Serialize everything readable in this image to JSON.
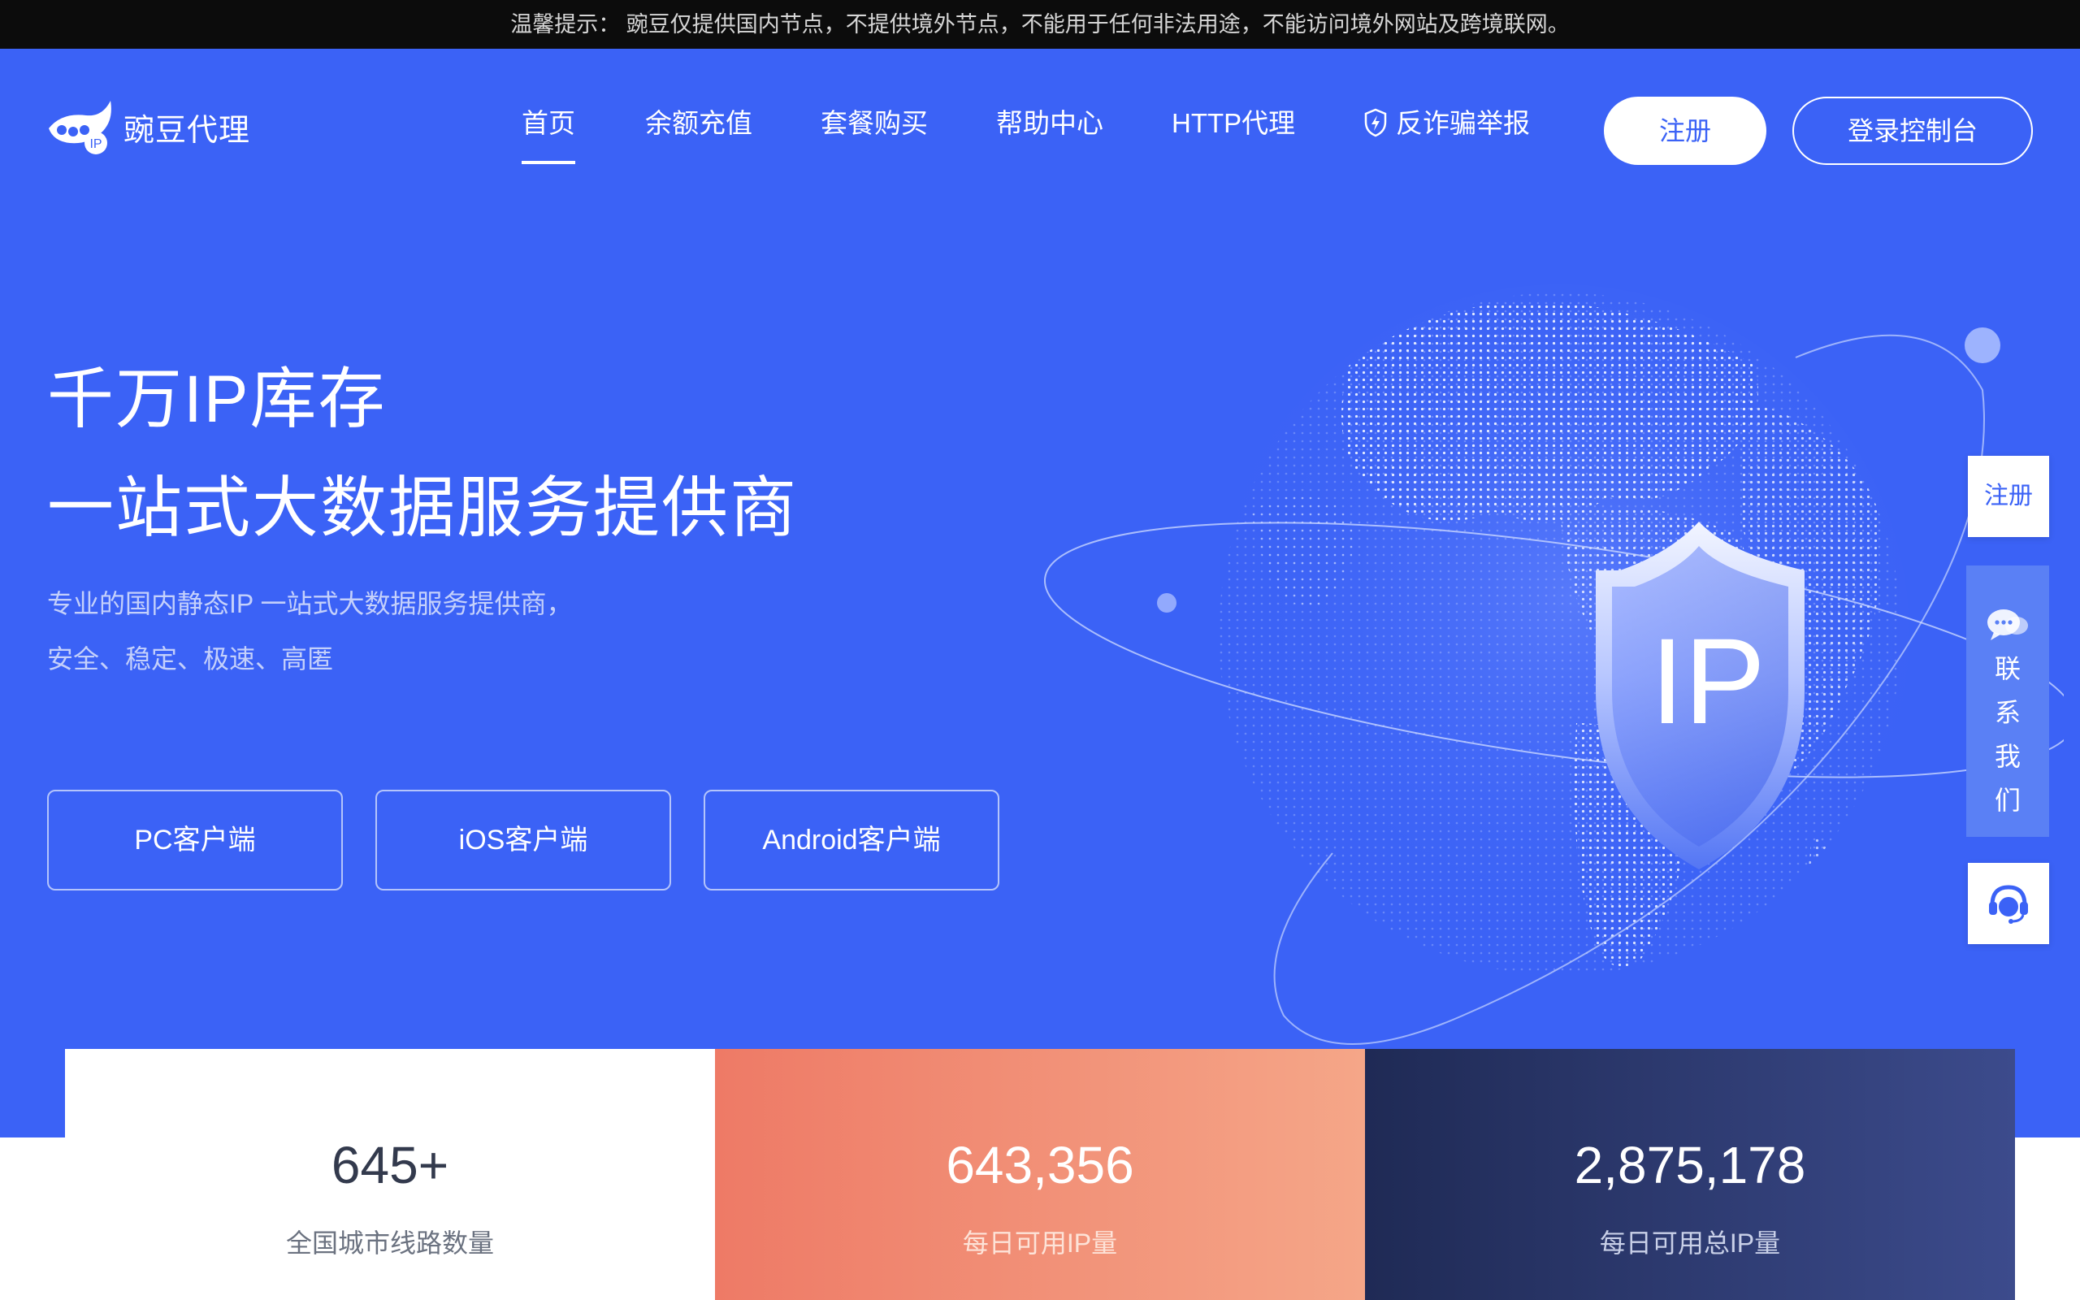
{
  "notice": {
    "text": "温馨提示： 豌豆仅提供国内节点，不提供境外节点，不能用于任何非法用途，不能访问境外网站及跨境联网。"
  },
  "header": {
    "logo_text": "豌豆代理",
    "nav": [
      {
        "label": "首页"
      },
      {
        "label": "余额充值"
      },
      {
        "label": "套餐购买"
      },
      {
        "label": "帮助中心"
      },
      {
        "label": "HTTP代理"
      },
      {
        "label": "反诈骗举报",
        "icon": "shield-icon"
      }
    ],
    "register_label": "注册",
    "login_label": "登录控制台"
  },
  "hero": {
    "title_line1": "千万IP库存",
    "title_line2": "一站式大数据服务提供商",
    "desc_line1": "专业的国内静态IP 一站式大数据服务提供商，",
    "desc_line2": "安全、稳定、极速、高匿",
    "buttons": [
      {
        "label": "PC客户端"
      },
      {
        "label": "iOS客户端"
      },
      {
        "label": "Android客户端"
      }
    ],
    "badge_text": "IP"
  },
  "side": {
    "register_label": "注册",
    "contact_chars": [
      "联",
      "系",
      "我",
      "们"
    ],
    "service_icon": "customer-service-icon"
  },
  "stats": [
    {
      "value": "645+",
      "label": "全国城市线路数量"
    },
    {
      "value": "643,356",
      "label": "每日可用IP量"
    },
    {
      "value": "2,875,178",
      "label": "每日可用总IP量"
    }
  ],
  "colors": {
    "primary": "#3b62f6",
    "notice_bg": "#0c0c0c",
    "stat_orange": "#ee7a66",
    "stat_navy": "#1f2a55"
  }
}
